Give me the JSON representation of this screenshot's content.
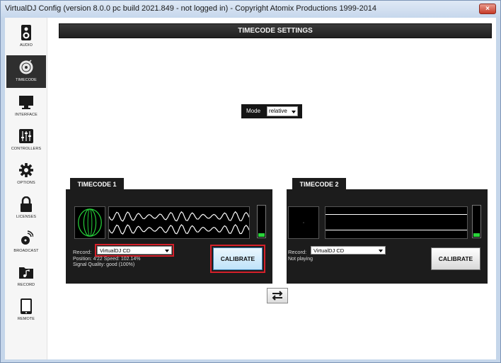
{
  "window": {
    "title": "VirtualDJ Config (version 8.0.0 pc build 2021.849 - not logged in) - Copyright Atomix Productions 1999-2014",
    "close_glyph": "×"
  },
  "sidebar": {
    "items": [
      {
        "label": "AUDIO",
        "icon": "speaker-icon"
      },
      {
        "label": "TIMECODE",
        "icon": "vinyl-icon",
        "active": true
      },
      {
        "label": "INTERFACE",
        "icon": "monitor-icon"
      },
      {
        "label": "CONTROLLERS",
        "icon": "sliders-icon"
      },
      {
        "label": "OPTIONS",
        "icon": "gear-icon"
      },
      {
        "label": "LICENSES",
        "icon": "lock-icon"
      },
      {
        "label": "BROADCAST",
        "icon": "broadcast-icon"
      },
      {
        "label": "RECORD",
        "icon": "music-folder-icon"
      },
      {
        "label": "REMOTE",
        "icon": "tablet-icon"
      }
    ]
  },
  "header": {
    "title": "TIMECODE SETTINGS"
  },
  "mode": {
    "label": "Mode",
    "value": "relative"
  },
  "timecode1": {
    "title": "TIMECODE 1",
    "record_label": "Record:",
    "record_value": "VirtualDJ CD",
    "position_line": "Position: 4'22  Speed: 102.14%",
    "signal_line": "Signal Quality: good (100%)",
    "calibrate_label": "CALIBRATE",
    "vu_level": 0.12
  },
  "timecode2": {
    "title": "TIMECODE 2",
    "record_label": "Record:",
    "record_value": "VirtualDJ CD",
    "status_line": "Not playing",
    "calibrate_label": "CALIBRATE",
    "vu_level": 0.12
  },
  "colors": {
    "accent_highlight": "#d4202a",
    "vu_green": "#2ad43a",
    "panel_bg": "#1c1c1c"
  }
}
